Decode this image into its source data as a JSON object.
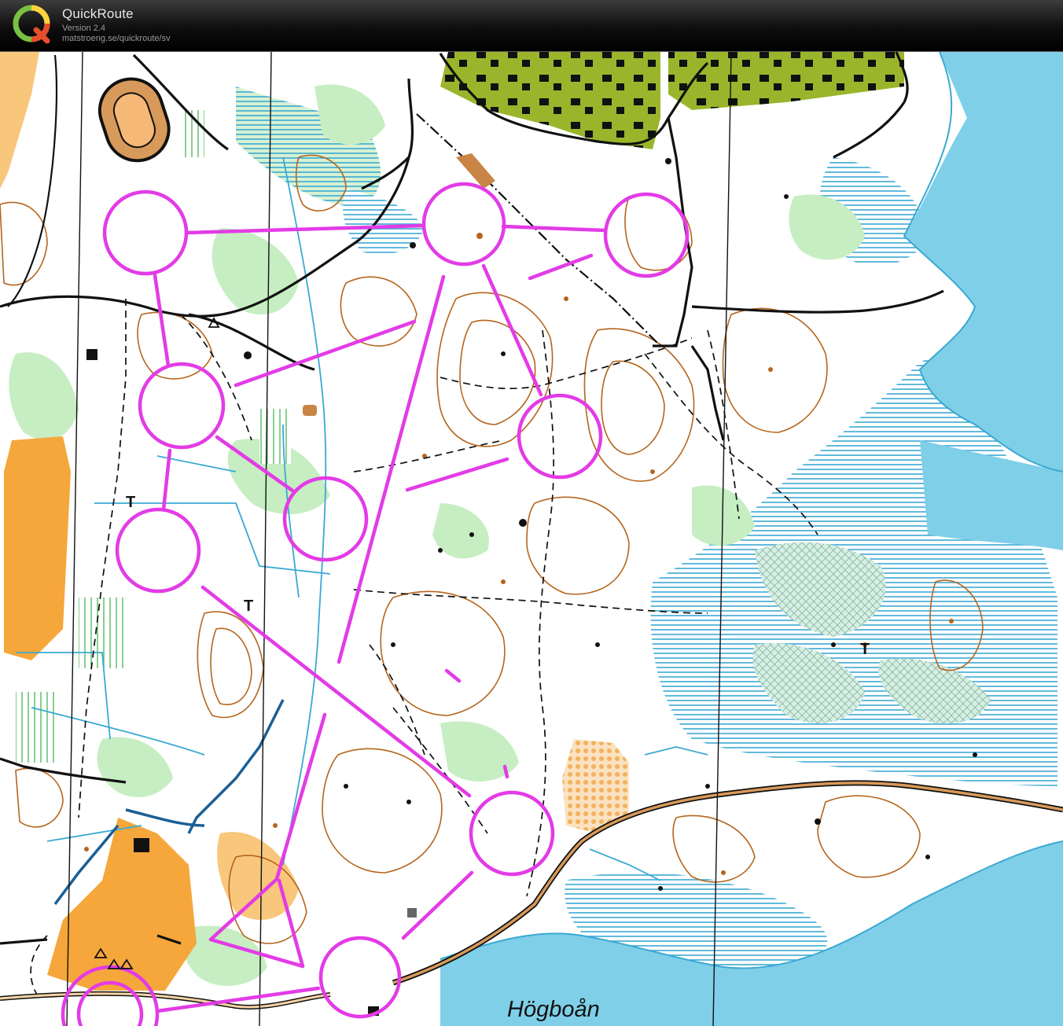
{
  "app": {
    "name": "QuickRoute",
    "version": "Version 2.4",
    "url": "matstroeng.se/quickroute/sv",
    "logo_letter": "Q"
  },
  "map": {
    "place_label": "Högboån",
    "symbols": {
      "thicket_mark": "T"
    },
    "colors": {
      "course_magenta": "#e33be6",
      "water": "#7fcfe8",
      "marsh": "#3aa9d3",
      "open_land": "#f5a73b",
      "contour": "#b5651d",
      "vegetation_green": "#c6eec2",
      "urban_olive": "#9ab52b",
      "road": "#111111"
    },
    "icons": [
      "app-logo-icon",
      "control-circle-icon"
    ]
  }
}
